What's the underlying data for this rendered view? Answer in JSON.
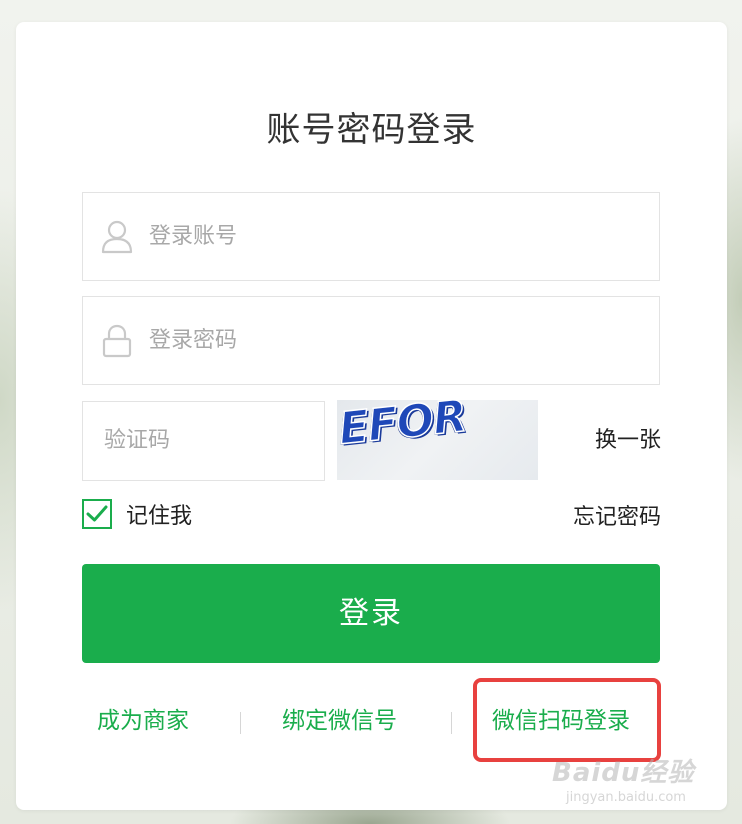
{
  "page": {
    "title": "账号密码登录"
  },
  "form": {
    "account_placeholder": "登录账号",
    "password_placeholder": "登录密码",
    "captcha_placeholder": "验证码",
    "captcha_code": "EFOR",
    "refresh_label": "换一张",
    "remember_label": "记住我",
    "remember_checked": true,
    "forgot_label": "忘记密码",
    "submit_label": "登录"
  },
  "footer_links": [
    {
      "label": "成为商家"
    },
    {
      "label": "绑定微信号"
    },
    {
      "label": "微信扫码登录"
    }
  ],
  "colors": {
    "accent": "#1aad4c",
    "highlight": "#e8413f"
  },
  "watermark": {
    "main": "Baidu经验",
    "sub": "jingyan.baidu.com"
  }
}
